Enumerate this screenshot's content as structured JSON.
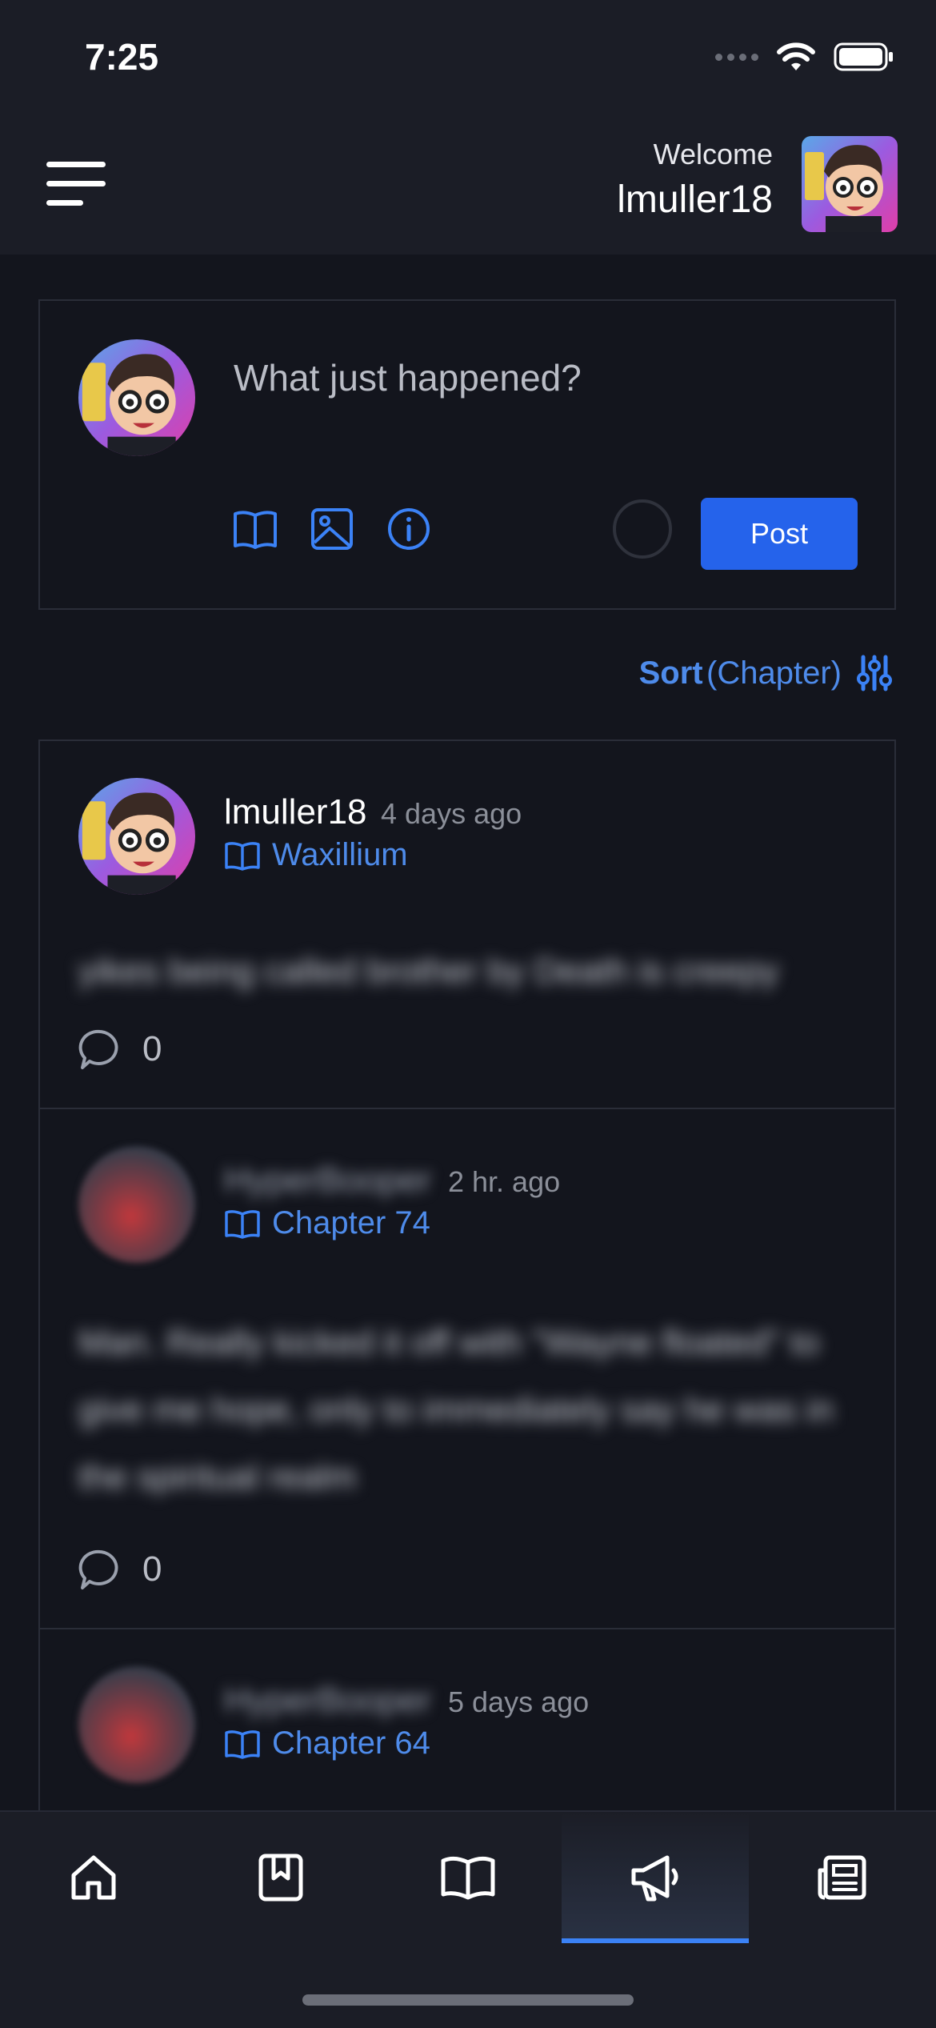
{
  "status_bar": {
    "time": "7:25"
  },
  "header": {
    "welcome": "Welcome",
    "username": "lmuller18"
  },
  "composer": {
    "placeholder": "What just happened?",
    "post_label": "Post"
  },
  "sort": {
    "label": "Sort",
    "value": "(Chapter)"
  },
  "posts": [
    {
      "author": "lmuller18",
      "time": "4 days ago",
      "chapter": "Waxillium",
      "body": "yikes being called brother by Death is creepy",
      "comments": "0"
    },
    {
      "author": "HyperBooper",
      "time": "2 hr. ago",
      "chapter": "Chapter 74",
      "body": "Man. Really kicked it off with \"Wayne floated\" to give me hope, only to immediately say he was in the spiritual realm",
      "comments": "0"
    },
    {
      "author": "HyperBooper",
      "time": "5 days ago",
      "chapter": "Chapter 64",
      "body": "",
      "comments": ""
    }
  ],
  "tabs": [
    {
      "icon": "home-icon"
    },
    {
      "icon": "bookmark-icon"
    },
    {
      "icon": "book-icon"
    },
    {
      "icon": "megaphone-icon",
      "active": true
    },
    {
      "icon": "newspaper-icon"
    }
  ],
  "colors": {
    "accent": "#2563eb",
    "link": "#4e8bea",
    "background": "#13151d",
    "surface": "#1b1d26"
  }
}
